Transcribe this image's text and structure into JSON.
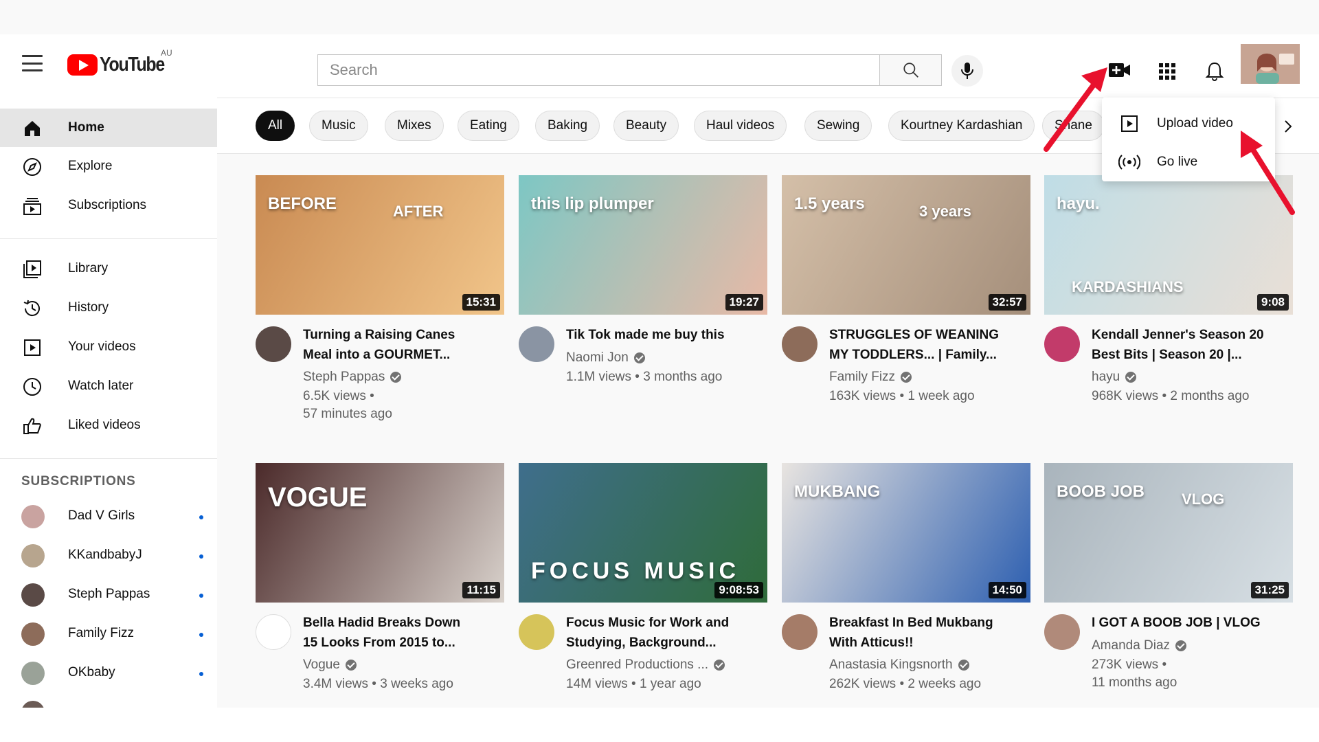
{
  "header": {
    "logo_text": "YouTube",
    "region": "AU",
    "search_placeholder": "Search"
  },
  "sidebar": {
    "primary": [
      {
        "label": "Home",
        "icon": "home-icon",
        "active": true
      },
      {
        "label": "Explore",
        "icon": "compass-icon"
      },
      {
        "label": "Subscriptions",
        "icon": "subscriptions-icon"
      }
    ],
    "library": [
      {
        "label": "Library",
        "icon": "library-icon"
      },
      {
        "label": "History",
        "icon": "history-icon"
      },
      {
        "label": "Your videos",
        "icon": "your-videos-icon"
      },
      {
        "label": "Watch later",
        "icon": "clock-icon"
      },
      {
        "label": "Liked videos",
        "icon": "thumbs-up-icon"
      }
    ],
    "subscriptions_heading": "SUBSCRIPTIONS",
    "subscriptions": [
      {
        "label": "Dad V Girls",
        "color": "#c9a3a0"
      },
      {
        "label": "KKandbabyJ",
        "color": "#b7a58e"
      },
      {
        "label": "Steph Pappas",
        "color": "#5a4a46"
      },
      {
        "label": "Family Fizz",
        "color": "#8d6c5a"
      },
      {
        "label": "OKbaby",
        "color": "#9aa298"
      }
    ]
  },
  "chips": [
    "All",
    "Music",
    "Mixes",
    "Eating",
    "Baking",
    "Beauty",
    "Haul videos",
    "Sewing",
    "Kourtney Kardashian",
    "Shane"
  ],
  "create_menu": {
    "items": [
      {
        "label": "Upload video",
        "icon": "upload-video-icon"
      },
      {
        "label": "Go live",
        "icon": "go-live-icon"
      }
    ]
  },
  "videos": [
    {
      "title_line1": "Turning a Raising Canes",
      "title_line2": "Meal into a GOURMET...",
      "channel": "Steph Pappas",
      "views": "6.5K views •",
      "age": "57 minutes ago",
      "duration": "15:31",
      "thumb_text": "BEFORE",
      "thumb_text2": "AFTER",
      "thumb_colors": [
        "#c98a52",
        "#f1c58a"
      ],
      "avatar_color": "#5a4a46"
    },
    {
      "title_line1": "Tik Tok made me buy this",
      "title_line2": "",
      "channel": "Naomi Jon",
      "views": "1.1M views • 3 months ago",
      "age": "",
      "duration": "19:27",
      "thumb_text": "this lip plumper",
      "thumb_text2": "",
      "thumb_colors": [
        "#7dc7c4",
        "#e8b9a6"
      ],
      "avatar_color": "#8a94a3"
    },
    {
      "title_line1": "STRUGGLES OF WEANING",
      "title_line2": "MY TODDLERS... | Family...",
      "channel": "Family Fizz",
      "views": "163K views • 1 week ago",
      "age": "",
      "duration": "32:57",
      "thumb_text": "1.5 years",
      "thumb_text2": "3 years",
      "thumb_colors": [
        "#d4bfa8",
        "#a58f7b"
      ],
      "avatar_color": "#8d6c5a"
    },
    {
      "title_line1": "Kendall Jenner's Season 20",
      "title_line2": "Best Bits | Season 20 |...",
      "channel": "hayu",
      "views": "968K views • 2 months ago",
      "age": "",
      "duration": "9:08",
      "thumb_text": "hayu.",
      "thumb_text2": "KARDASHIANS",
      "thumb_colors": [
        "#bfdde6",
        "#e9dfd6"
      ],
      "avatar_color": "#c23b6a"
    },
    {
      "title_line1": "Bella Hadid Breaks Down",
      "title_line2": "15 Looks From 2015 to...",
      "channel": "Vogue",
      "views": "3.4M views • 3 weeks ago",
      "age": "",
      "duration": "11:15",
      "thumb_text": "VOGUE",
      "thumb_text2": "",
      "thumb_colors": [
        "#4b2a2a",
        "#d9d2cc"
      ],
      "avatar_color": "#ffffff"
    },
    {
      "title_line1": "Focus Music for Work and",
      "title_line2": "Studying, Background...",
      "channel": "Greenred Productions ...",
      "views": "14M views • 1 year ago",
      "age": "",
      "duration": "9:08:53",
      "thumb_text": "FOCUS MUSIC",
      "thumb_text2": "",
      "thumb_colors": [
        "#3f6e8c",
        "#2f6b3a"
      ],
      "avatar_color": "#d6c45a"
    },
    {
      "title_line1": "Breakfast In Bed Mukbang",
      "title_line2": "With Atticus!!",
      "channel": "Anastasia Kingsnorth",
      "views": "262K views • 2 weeks ago",
      "age": "",
      "duration": "14:50",
      "thumb_text": "MUKBANG",
      "thumb_text2": "",
      "thumb_colors": [
        "#e8e4e0",
        "#2d5fb0"
      ],
      "avatar_color": "#a57c68"
    },
    {
      "title_line1": "I GOT A BOOB JOB | VLOG",
      "title_line2": "",
      "channel": "Amanda Diaz",
      "views": "273K views •",
      "age": "11 months ago",
      "duration": "31:25",
      "thumb_text": "BOOB JOB",
      "thumb_text2": "VLOG",
      "thumb_colors": [
        "#a9b4bc",
        "#d7dfe4"
      ],
      "avatar_color": "#b08a7a"
    }
  ],
  "colors": {
    "brand_red": "#ff0000",
    "annotation_arrow": "#e8112d",
    "unread_dot": "#065fd4"
  }
}
